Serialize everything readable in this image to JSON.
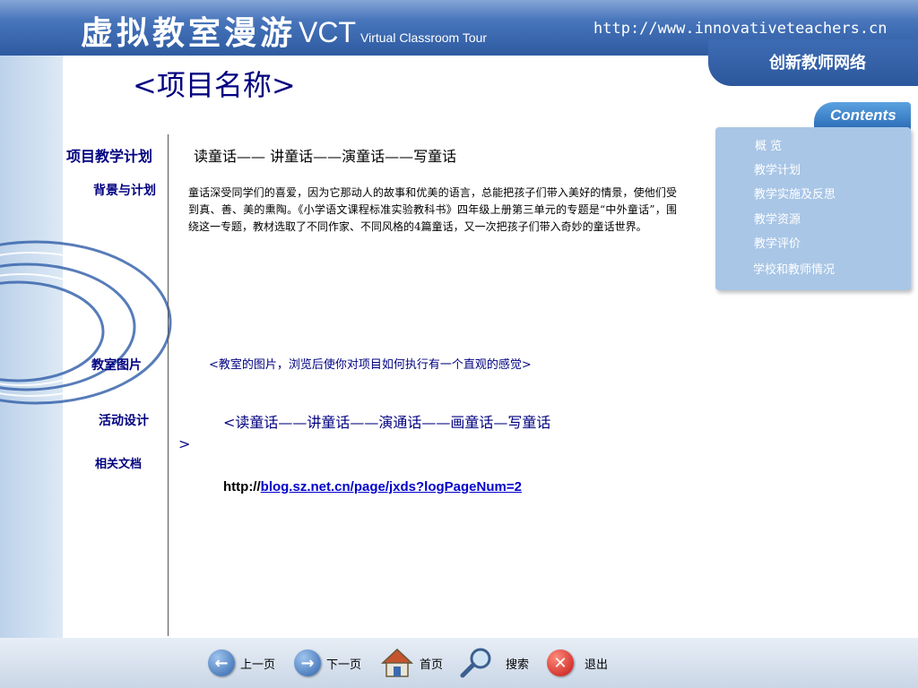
{
  "header": {
    "title_cn": "虚拟教室漫游",
    "title_vct": "VCT",
    "title_sub": "Virtual Classroom Tour",
    "site_url": "http://www.innovativeteachers.cn",
    "brand": "创新教师网络"
  },
  "page_title": "<项目名称>",
  "sections": {
    "plan": {
      "label": "项目教学计划",
      "text": "读童话——  讲童话——演童话——写童话"
    },
    "background": {
      "label": "背景与计划",
      "text": "童话深受同学们的喜爱，因为它那动人的故事和优美的语言，总能把孩子们带入美好的情景，使他们受到真、善、美的熏陶。《小学语文课程标准实验教科书》四年级上册第三单元的专题是“中外童话”，围绕这一专题，教材选取了不同作家、不同风格的4篇童话，又一次把孩子们带入奇妙的童话世界。"
    },
    "photo": {
      "label": "教室图片",
      "text": "<教室的图片，浏览后使你对项目如何执行有一个直观的感觉>"
    },
    "activity": {
      "label": "活动设计",
      "text": "<读童话——讲童话——演通话——画童话—写童话",
      "close": ">"
    },
    "docs": {
      "label": "相关文档",
      "prefix": "http://",
      "link": "blog.sz.net.cn/page/jxds?logPageNum=2"
    }
  },
  "contents": {
    "title": "Contents",
    "items": [
      "概  览",
      "教学计划",
      "教学实施及反思",
      "教学资源",
      "教学评价",
      "学校和教师情况"
    ]
  },
  "footer": {
    "prev": "上一页",
    "next": "下一页",
    "home": "首页",
    "search": "搜索",
    "exit": "退出"
  },
  "colors": {
    "header": "#3f6db4",
    "label": "#000080",
    "link": "#0000cc",
    "panel": "#a9c6e6"
  }
}
